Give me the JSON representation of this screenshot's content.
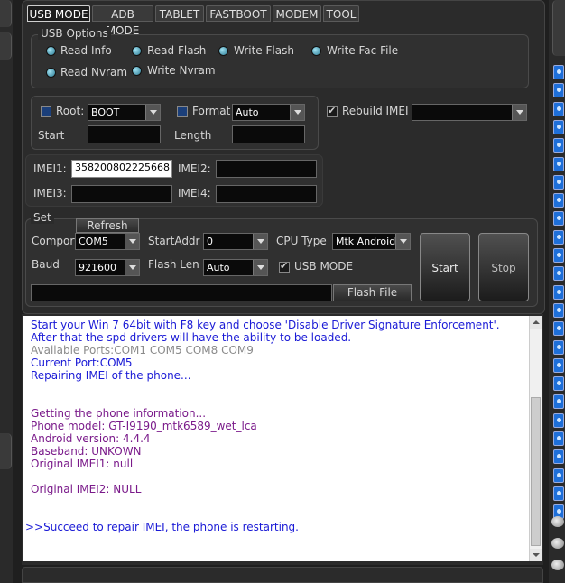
{
  "tabs": [
    "USB MODE",
    "ADB MODE",
    "TABLET",
    "FASTBOOT",
    "MODEM",
    "TOOL"
  ],
  "usb_options": {
    "title": "USB Options",
    "items": [
      "Read Info",
      "Read Flash",
      "Write Flash",
      "Write Fac File",
      "Read Nvram",
      "Write Nvram"
    ]
  },
  "flash": {
    "root_label": "Root:",
    "root_value": "BOOT",
    "format_label": "Format",
    "format_value": "Auto",
    "rebuild_label": "Rebuild IMEI",
    "rebuild_value": "",
    "start_label": "Start",
    "start_value": "",
    "length_label": "Length",
    "length_value": ""
  },
  "imei": {
    "imei1_label": "IMEI1:",
    "imei1_value": "358200802225668",
    "imei2_label": "IMEI2:",
    "imei2_value": "",
    "imei3_label": "IMEI3:",
    "imei3_value": "",
    "imei4_label": "IMEI4:",
    "imei4_value": ""
  },
  "set": {
    "title": "Set",
    "refresh": "Refresh",
    "comport_label": "Comport",
    "comport_value": "COM5",
    "startaddr_label": "StartAddr",
    "startaddr_value": "0",
    "cputype_label": "CPU Type",
    "cputype_value": "Mtk Android",
    "baud_label": "Baud",
    "baud_value": "921600",
    "flashlen_label": "Flash Len",
    "flashlen_value": "Auto",
    "usbmode_label": "USB MODE",
    "flash_file_path": "",
    "flash_file_button": "Flash File",
    "start_button": "Start",
    "stop_button": "Stop"
  },
  "log": [
    {
      "text": "Start your Win 7 64bit with F8 key and choose 'Disable Driver Signature Enforcement'.",
      "color": "#1a1ad6"
    },
    {
      "text": "After that the spd drivers will have the ability to be loaded.",
      "color": "#1a1ad6"
    },
    {
      "text": "Available Ports:COM1 COM5 COM8 COM9",
      "color": "#8a8a8a"
    },
    {
      "text": "Current Port:COM5",
      "color": "#1a1ad6"
    },
    {
      "text": "Repairing IMEI of the phone...",
      "color": "#1a1ad6"
    },
    {
      "text": "Getting the phone information...",
      "color": "#7a1a8a"
    },
    {
      "text": "Phone model: GT-I9190_mtk6589_wet_lca",
      "color": "#7a1a8a"
    },
    {
      "text": "Android version: 4.4.4",
      "color": "#7a1a8a"
    },
    {
      "text": "Baseband: UNKOWN",
      "color": "#7a1a8a"
    },
    {
      "text": "Original IMEI1:  null",
      "color": "#7a1a8a"
    },
    {
      "text": "Original IMEI2: NULL",
      "color": "#7a1a8a"
    },
    {
      "text": ">>Succeed to repair IMEI, the phone is restarting.",
      "color": "#1a1ad6"
    }
  ],
  "colors": {
    "background": "#1f1f1f",
    "panel": "#2b2b2b",
    "log_blue": "#1a1ad6",
    "log_purple": "#7a1a8a",
    "log_gray": "#8a8a8a",
    "side_icon": "#1e6fd9"
  }
}
